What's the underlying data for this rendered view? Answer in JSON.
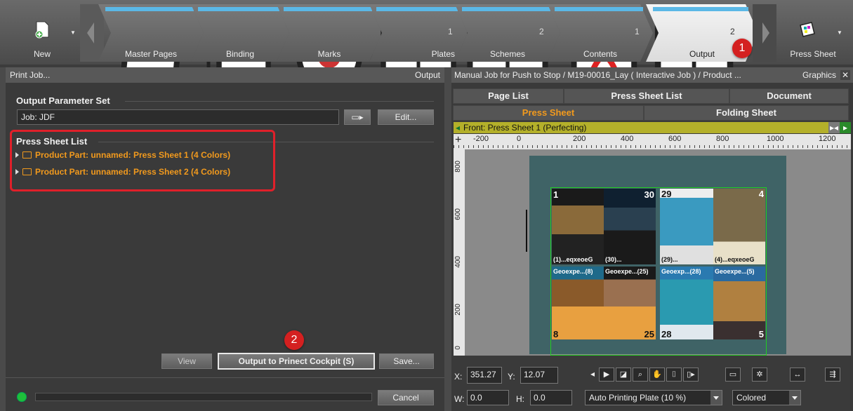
{
  "workflow": {
    "new_label": "New",
    "press_sheet_label": "Press Sheet",
    "steps": [
      {
        "label": "Master Pages",
        "count": ""
      },
      {
        "label": "Binding",
        "count": ""
      },
      {
        "label": "Marks",
        "count": ""
      },
      {
        "label": "Plates",
        "count": "1"
      },
      {
        "label": "Schemes",
        "count": "2"
      },
      {
        "label": "Contents",
        "count": "1"
      },
      {
        "label": "Output",
        "count": "2"
      }
    ],
    "badge1": "1",
    "badge2": "2",
    "accent": "#5bb8e6"
  },
  "left": {
    "header_title": "Print Job...",
    "header_right": "Output",
    "output_param_title": "Output Parameter Set",
    "job_value": "Job: JDF",
    "edit_label": "Edit...",
    "press_sheet_list_title": "Press Sheet List",
    "items": [
      "Product Part: unnamed: Press Sheet 1 (4 Colors)",
      "Product Part: unnamed: Press Sheet 2 (4 Colors)"
    ],
    "view_label": "View",
    "output_label": "Output to Prinect Cockpit (S)",
    "save_label": "Save...",
    "cancel_label": "Cancel"
  },
  "right": {
    "header_title": "Manual Job for Push to Stop / M19-00016_Lay ( Interactive Job ) / Product ...",
    "header_right": "Graphics",
    "tabs1": [
      "Page List",
      "Press Sheet List",
      "Document"
    ],
    "tabs2": [
      "Press Sheet",
      "Folding Sheet"
    ],
    "sheet_title": "Front:  Press Sheet 1 (Perfecting)",
    "ruler_ticks": [
      "-200",
      "0",
      "200",
      "400",
      "600",
      "800",
      "1000",
      "1200"
    ],
    "vruler_ticks": [
      "800",
      "600",
      "400",
      "200",
      "0"
    ],
    "page_labels_top": [
      "(1)...eqxeoeG",
      "(30)...",
      "(29)...",
      "(4)...eqxeoeG"
    ],
    "page_labels_bottom": [
      "Geoexpe...(8)",
      "Geoexpe...(25)",
      "Geoexp...(28)",
      "Geoexpe...(5)"
    ],
    "page_numbers_top": [
      "1",
      "30",
      "29",
      "4"
    ],
    "page_numbers_bottom": [
      "8",
      "25",
      "28",
      "5"
    ],
    "x_label": "X:",
    "x_value": "351.27",
    "y_label": "Y:",
    "y_value": "12.07",
    "w_label": "W:",
    "w_value": "0.0",
    "h_label": "H:",
    "h_value": "0.0",
    "plate_dropdown": "Auto Printing Plate (10 %)",
    "color_dropdown": "Colored"
  }
}
